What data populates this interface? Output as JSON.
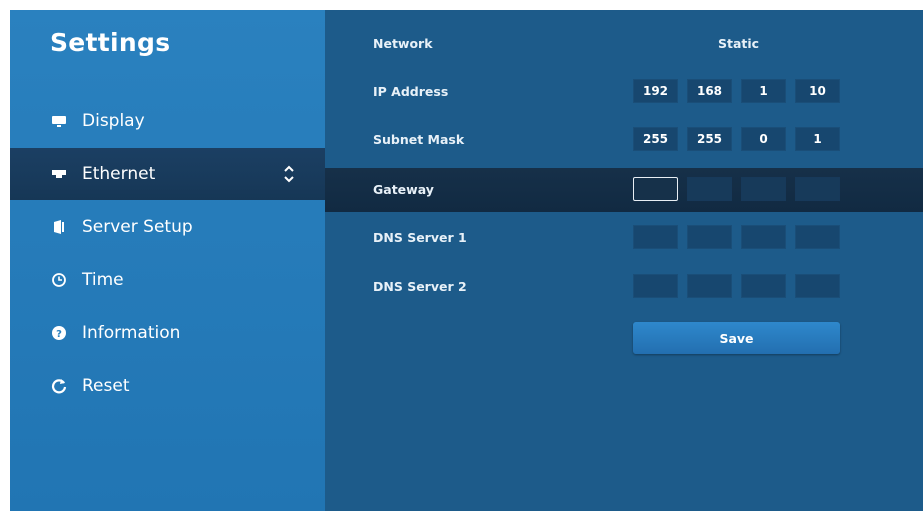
{
  "sidebar": {
    "title": "Settings",
    "items": [
      {
        "label": "Display",
        "icon": "monitor-icon"
      },
      {
        "label": "Ethernet",
        "icon": "ethernet-icon",
        "active": true
      },
      {
        "label": "Server Setup",
        "icon": "server-icon"
      },
      {
        "label": "Time",
        "icon": "clock-icon"
      },
      {
        "label": "Information",
        "icon": "question-circle-icon"
      },
      {
        "label": "Reset",
        "icon": "reset-icon"
      }
    ]
  },
  "main": {
    "network": {
      "label": "Network",
      "value": "Static"
    },
    "ip_address": {
      "label": "IP Address",
      "octets": [
        "192",
        "168",
        "1",
        "10"
      ]
    },
    "subnet_mask": {
      "label": "Subnet Mask",
      "octets": [
        "255",
        "255",
        "0",
        "1"
      ]
    },
    "gateway": {
      "label": "Gateway",
      "octets": [
        "",
        "",
        "",
        ""
      ]
    },
    "dns1": {
      "label": "DNS Server 1",
      "octets": [
        "",
        "",
        "",
        ""
      ]
    },
    "dns2": {
      "label": "DNS Server 2",
      "octets": [
        "",
        "",
        "",
        ""
      ]
    },
    "save_label": "Save"
  },
  "colors": {
    "sidebar_bg": "#2a81bf",
    "sidebar_active": "#1b3f63",
    "main_bg": "#1d5b8a",
    "active_row": "#163049",
    "button": "#2e88cc"
  }
}
